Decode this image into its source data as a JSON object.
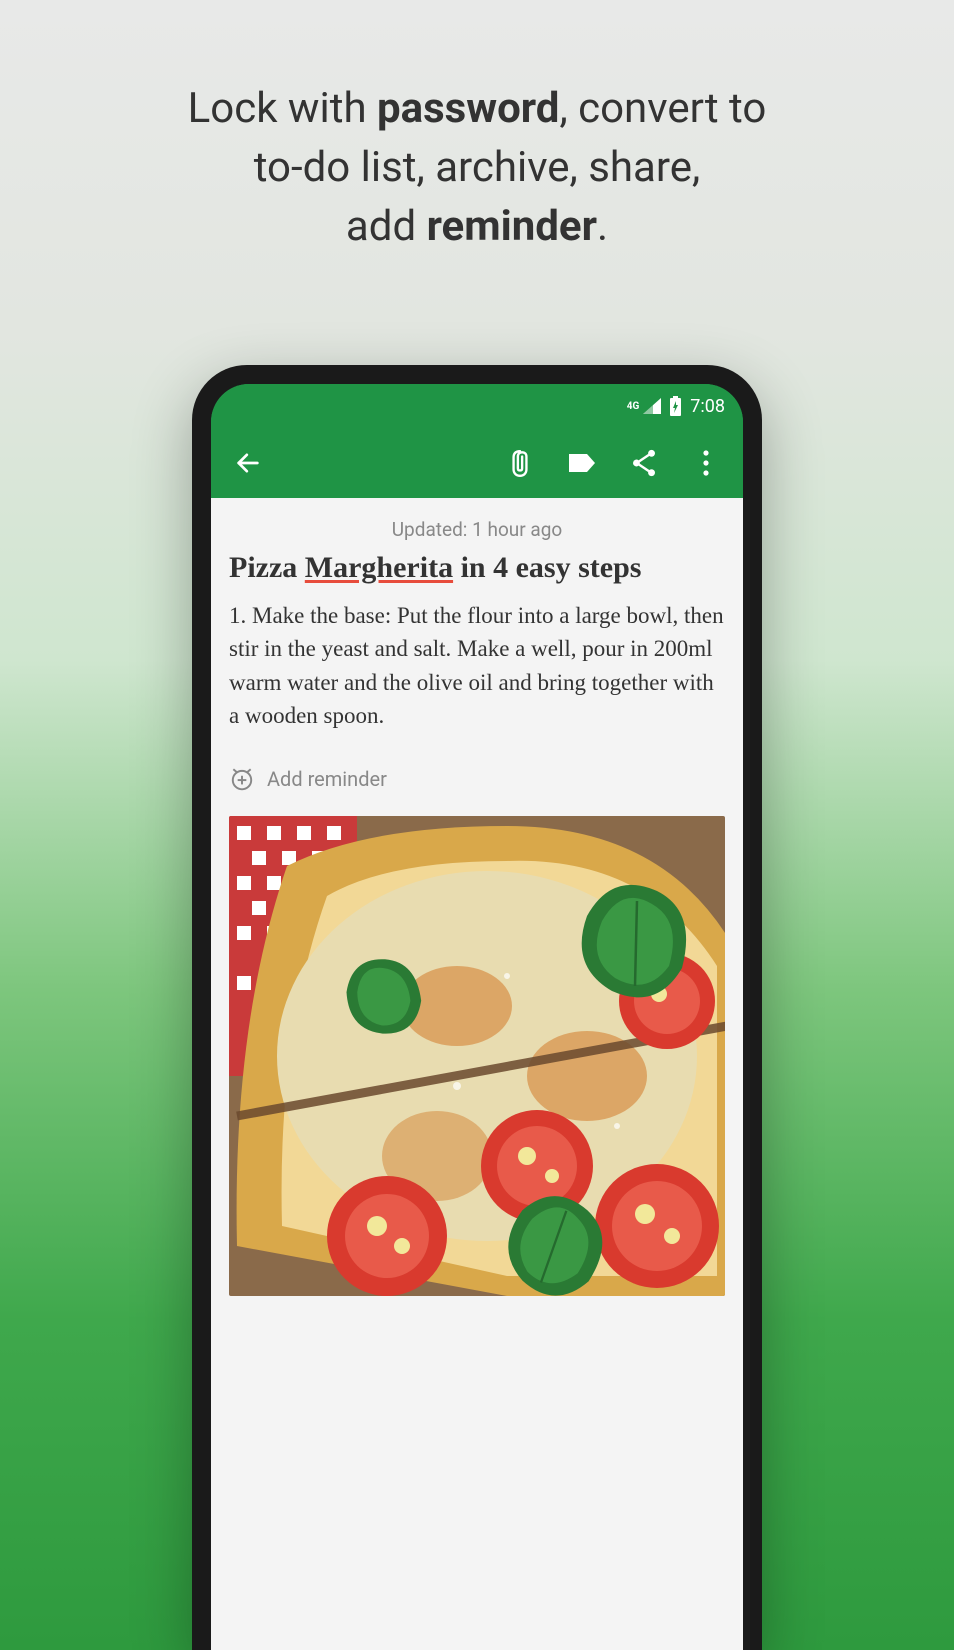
{
  "promo": {
    "line1_pre": "Lock with ",
    "line1_bold": "password",
    "line1_post": ", convert to",
    "line2": "to-do list, archive, share,",
    "line3_pre": "add ",
    "line3_bold": "reminder",
    "line3_post": "."
  },
  "status": {
    "network": "4G",
    "time": "7:08"
  },
  "note": {
    "updated": "Updated: 1 hour ago",
    "title_pre": "Pizza ",
    "title_underline": "Margherita",
    "title_post": " in 4 easy steps",
    "body": "1. Make the base: Put the flour into a large bowl, then stir in the yeast and salt. Make a well, pour in 200ml warm water and the olive oil and bring together with a wooden spoon."
  },
  "reminder": {
    "label": "Add reminder"
  }
}
